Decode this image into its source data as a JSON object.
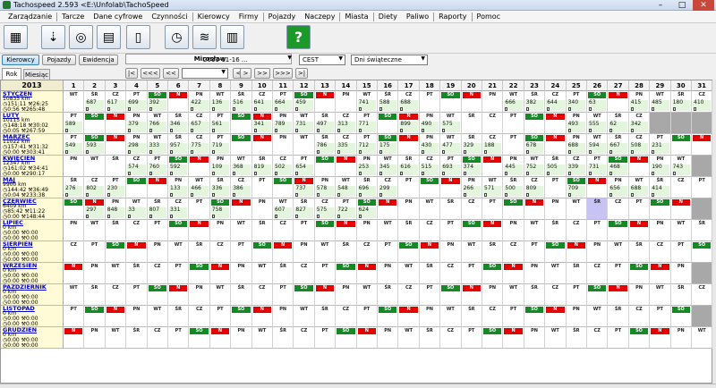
{
  "window": {
    "title": "Tachospeed 2.593 <E:\\Unfolab\\TachoSpeed"
  },
  "menu": [
    "Zarządzanie",
    "Tarcze",
    "Dane cyfrowe",
    "Czynności",
    "Kierowcy",
    "Firmy",
    "Pojazdy",
    "Naczepy",
    "Miasta",
    "Diety",
    "Paliwo",
    "Raporty",
    "Pomoc"
  ],
  "menu_separators_after": [
    0,
    3,
    5,
    7,
    8,
    10,
    11
  ],
  "toolbar": {
    "icons": [
      "drivers-grid-icon",
      "card-reader-icon",
      "tachograph-disk-icon",
      "document-icon",
      "phone-card-icon",
      "clock-icon",
      "database-icon",
      "report-icon",
      "help-icon"
    ],
    "help_glyph": "?"
  },
  "nav": {
    "btn_kierowcy": "Kierowcy",
    "btn_pojazdy": "Pojazdy",
    "btn_ewidencja": "Ewidencja",
    "driver": "Mirosław",
    "date": "2011-11-16 ...",
    "first": "|<",
    "prev3": "<<<",
    "prev2": "<<",
    "prev1": "<",
    "next1": ">",
    "next2": ">>",
    "next3": ">>>",
    "last": ">|",
    "timezone": "CEST",
    "holiday": "Dni świąteczne"
  },
  "tabs": {
    "rok": "Rok",
    "miesiac": "Miesiąc"
  },
  "year": "2013",
  "days": [
    "1",
    "2",
    "3",
    "4",
    "5",
    "6",
    "7",
    "8",
    "9",
    "10",
    "11",
    "12",
    "13",
    "14",
    "15",
    "16",
    "17",
    "18",
    "19",
    "20",
    "21",
    "22",
    "23",
    "24",
    "25",
    "26",
    "27",
    "28",
    "29",
    "30",
    "31"
  ],
  "months": [
    {
      "name": "STYCZEŃ",
      "km": "10835 km",
      "l1": "151:11",
      "l1b": "26:25",
      "l2": "0:56",
      "l2b": "265:48",
      "start": 1,
      "len": 31,
      "km_vals": [
        "",
        "687",
        "617",
        "699",
        "392",
        "",
        "422",
        "136",
        "516",
        "641",
        "664",
        "459",
        "",
        "",
        "741",
        "588",
        "688",
        "",
        "",
        "",
        "",
        "666",
        "382",
        "644",
        "340",
        "63",
        "",
        "415",
        "485",
        "180",
        "410"
      ]
    },
    {
      "name": "LUTY",
      "km": "10115 km",
      "l1": "148:18",
      "l1b": "30:02",
      "l2": "0:05",
      "l2b": "267:59",
      "start": 4,
      "len": 28,
      "km_vals": [
        "589",
        "",
        "",
        "379",
        "766",
        "346",
        "657",
        "561",
        "",
        "341",
        "789",
        "731",
        "497",
        "313",
        "771",
        "",
        "899",
        "490",
        "575",
        "",
        "",
        "",
        "",
        "",
        "493",
        "555",
        "62",
        "342",
        "",
        "",
        ""
      ]
    },
    {
      "name": "MARZEC",
      "km": "11022 km",
      "l1": "157:41",
      "l1b": "31:32",
      "l2": "0:00",
      "l2b": "303:41",
      "start": 4,
      "len": 31,
      "km_vals": [
        "549",
        "593",
        "",
        "298",
        "333",
        "957",
        "775",
        "719",
        "",
        "",
        "",
        "",
        "786",
        "335",
        "712",
        "175",
        "",
        "430",
        "477",
        "329",
        "188",
        "",
        "678",
        "",
        "688",
        "594",
        "667",
        "508",
        "231",
        "",
        ""
      ]
    },
    {
      "name": "KWIECIEŃ",
      "km": "12347 km",
      "l1": "161:02",
      "l1b": "34:41",
      "l2": "0:00",
      "l2b": "290:17",
      "start": 0,
      "len": 30,
      "km_vals": [
        "",
        "",
        "",
        "574",
        "760",
        "592",
        "",
        "109",
        "368",
        "819",
        "502",
        "654",
        "",
        "",
        "253",
        "345",
        "616",
        "515",
        "693",
        "374",
        "",
        "445",
        "752",
        "505",
        "339",
        "731",
        "468",
        "",
        "190",
        "743",
        ""
      ]
    },
    {
      "name": "MAJ",
      "km": "9900 km",
      "l1": "144:42",
      "l1b": "36:49",
      "l2": "0:04",
      "l2b": "233:38",
      "start": 2,
      "len": 31,
      "km_vals": [
        "276",
        "802",
        "230",
        "",
        "",
        "133",
        "466",
        "336",
        "386",
        "",
        "",
        "737",
        "578",
        "548",
        "696",
        "299",
        "",
        "",
        "",
        "266",
        "571",
        "500",
        "809",
        "",
        "709",
        "",
        "656",
        "688",
        "414",
        "",
        ""
      ]
    },
    {
      "name": "CZERWIEC",
      "km": "6409 km",
      "l1": "85:42",
      "l1b": "11:22",
      "l2": "0:00",
      "l2b": "148:44",
      "start": 5,
      "len": 30,
      "km_vals": [
        "",
        "297",
        "848",
        "33",
        "807",
        "331",
        "",
        "758",
        "",
        "",
        "607",
        "827",
        "575",
        "722",
        "624",
        "",
        "",
        "",
        "",
        "",
        "",
        "",
        "",
        "",
        "",
        "",
        "",
        "",
        "",
        "",
        ""
      ]
    },
    {
      "name": "LIPIEC",
      "km": "0 km",
      "l1": "0:00",
      "l1b": "0:00",
      "l2": "0:00",
      "l2b": "0:00",
      "start": 0,
      "len": 31,
      "km_vals": []
    },
    {
      "name": "SIERPIEŃ",
      "km": "0 km",
      "l1": "0:00",
      "l1b": "0:00",
      "l2": "0:00",
      "l2b": "0:00",
      "start": 3,
      "len": 31,
      "km_vals": []
    },
    {
      "name": "WRZESIEŃ",
      "km": "0 km",
      "l1": "0:00",
      "l1b": "0:00",
      "l2": "0:00",
      "l2b": "0:00",
      "start": 6,
      "len": 30,
      "km_vals": []
    },
    {
      "name": "PAŹDZIERNIK",
      "km": "0 km",
      "l1": "0:00",
      "l1b": "0:00",
      "l2": "0:00",
      "l2b": "0:00",
      "start": 1,
      "len": 31,
      "km_vals": []
    },
    {
      "name": "LISTOPAD",
      "km": "0 km",
      "l1": "0:00",
      "l1b": "0:00",
      "l2": "0:00",
      "l2b": "0:00",
      "start": 4,
      "len": 30,
      "km_vals": []
    },
    {
      "name": "GRUDZIEŃ",
      "km": "0 km",
      "l1": "0:00",
      "l1b": "0:00",
      "l2": "0:00",
      "l2b": "0:00",
      "start": 6,
      "len": 31,
      "km_vals": []
    }
  ],
  "weekday_abbr": [
    "PN",
    "WT",
    "ŚR",
    "CZ",
    "PT",
    "SO",
    "N"
  ],
  "colors": {
    "sunday": "#e60000",
    "saturday": "#138a24",
    "month_name": "#0000c8",
    "month_bg": "#fffbd6",
    "inactive": "#a8a8a8",
    "activity": "#e3f5dc"
  }
}
